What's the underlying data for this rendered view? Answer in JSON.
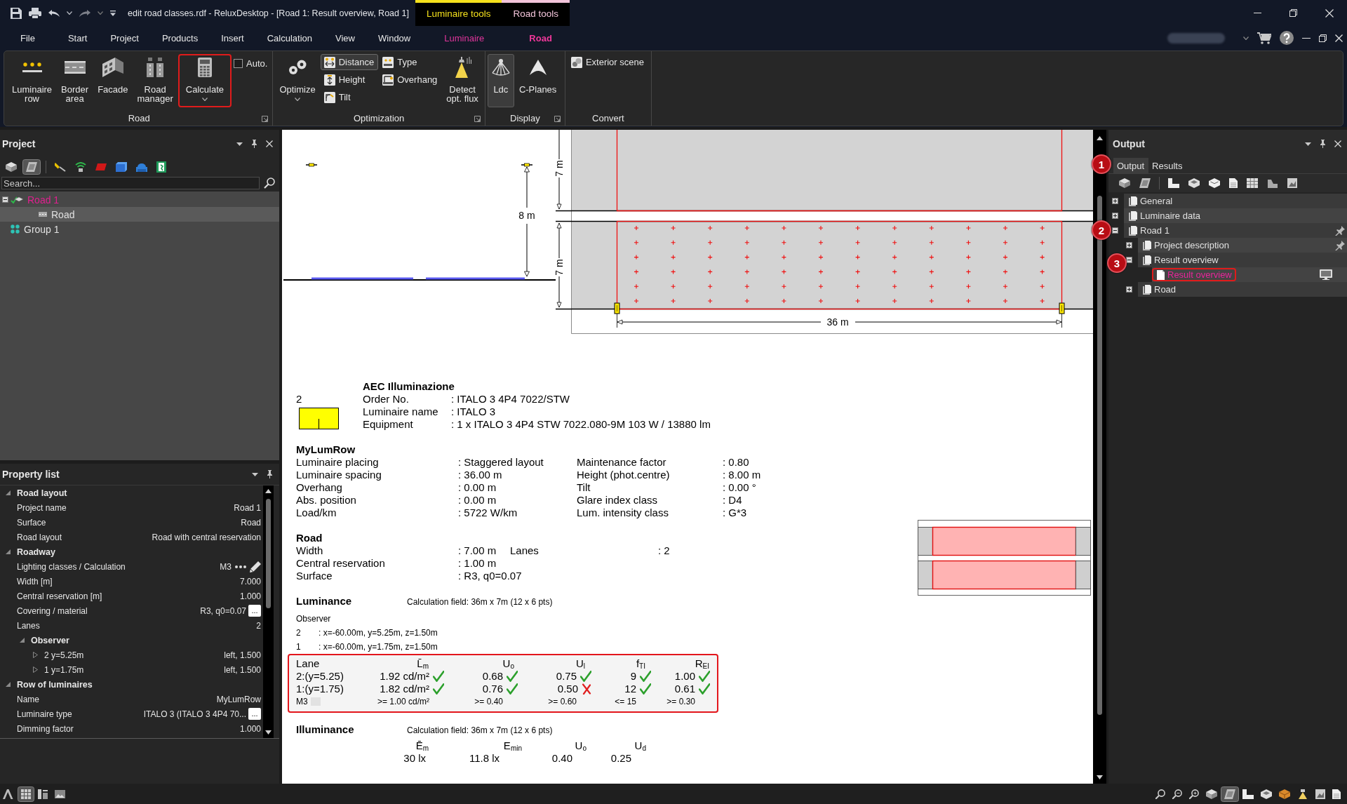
{
  "title_bar": {
    "title": "edit road classes.rdf - ReluxDesktop - [Road 1: Result overview, Road 1]",
    "context_tabs": [
      {
        "label": "Luminaire tools",
        "color": "#f5e11c"
      },
      {
        "label": "Road tools",
        "color": "#f2c4da"
      }
    ]
  },
  "menu": [
    {
      "label": "File",
      "kind": "main",
      "selected": false
    },
    {
      "label": "Start",
      "kind": "main",
      "selected": false
    },
    {
      "label": "Project",
      "kind": "main",
      "selected": false
    },
    {
      "label": "Products",
      "kind": "main",
      "selected": false
    },
    {
      "label": "Insert",
      "kind": "main",
      "selected": false
    },
    {
      "label": "Calculation",
      "kind": "main",
      "selected": false
    },
    {
      "label": "View",
      "kind": "main",
      "selected": false
    },
    {
      "label": "Window",
      "kind": "main",
      "selected": false
    },
    {
      "label": "Luminaire",
      "kind": "context",
      "selected": false
    },
    {
      "label": "Road",
      "kind": "context",
      "selected": true
    }
  ],
  "ribbon": [
    {
      "label": "Road",
      "launcher": true,
      "items": [
        {
          "kind": "large",
          "label": "Luminaire\nrow",
          "pressed": false,
          "dropdown": false,
          "highlighted": false
        },
        {
          "kind": "large",
          "label": "Border\narea",
          "pressed": false,
          "dropdown": false,
          "highlighted": false
        },
        {
          "kind": "large",
          "label": "Facade",
          "pressed": false,
          "dropdown": false,
          "highlighted": false
        },
        {
          "kind": "large",
          "label": "Road\nmanager",
          "pressed": false,
          "dropdown": false,
          "highlighted": false
        },
        {
          "kind": "large",
          "label": "Calculate",
          "pressed": false,
          "dropdown": true,
          "highlighted": true
        },
        {
          "kind": "checkbox",
          "label": "Auto.",
          "checked": false
        }
      ]
    },
    {
      "label": "Optimization",
      "launcher": true,
      "items": [
        {
          "kind": "large",
          "label": "Optimize",
          "pressed": false,
          "dropdown": true,
          "highlighted": false
        },
        {
          "kind": "stack",
          "buttons": [
            {
              "label": "Distance",
              "pressed": true
            },
            {
              "label": "Height",
              "pressed": false
            },
            {
              "label": "Tilt",
              "pressed": false
            }
          ]
        },
        {
          "kind": "stack",
          "buttons": [
            {
              "label": "Type",
              "pressed": false
            },
            {
              "label": "Overhang",
              "pressed": false
            }
          ]
        },
        {
          "kind": "large",
          "label": "Detect\nopt. flux",
          "pressed": false,
          "dropdown": false,
          "highlighted": false
        }
      ]
    },
    {
      "label": "Display",
      "launcher": true,
      "items": [
        {
          "kind": "large",
          "label": "Ldc",
          "pressed": true,
          "dropdown": false,
          "highlighted": false
        },
        {
          "kind": "large",
          "label": "C-Planes",
          "pressed": false,
          "dropdown": false,
          "highlighted": false
        }
      ]
    },
    {
      "label": "Convert",
      "launcher": false,
      "items": [
        {
          "kind": "stack",
          "buttons": [
            {
              "label": "Exterior scene",
              "pressed": false
            }
          ]
        }
      ]
    }
  ],
  "project_panel": {
    "title": "Project",
    "toolbar": [
      {
        "pressed": false
      },
      {
        "pressed": true
      },
      {
        "pressed": false
      },
      {
        "pressed": false
      },
      {
        "pressed": false
      },
      {
        "pressed": false
      },
      {
        "pressed": false
      },
      {
        "pressed": false
      }
    ],
    "search": {
      "placeholder": "Search..."
    },
    "tree": [
      {
        "label": "Road 1",
        "kind": "project",
        "active": true,
        "selected": false,
        "expanded": true,
        "children": [
          {
            "label": "Road",
            "kind": "road",
            "active": false,
            "selected": true
          }
        ]
      },
      {
        "label": "Group 1",
        "kind": "group",
        "active": false,
        "selected": false
      }
    ]
  },
  "property_list": {
    "title": "Property list",
    "sections": [
      {
        "label": "Road layout",
        "expanded": true,
        "rows": [
          {
            "kind": "value",
            "name": "Project name",
            "value": "Road 1"
          },
          {
            "kind": "value",
            "name": "Surface",
            "value": "Road"
          },
          {
            "kind": "value",
            "name": "Road layout",
            "value": "Road with central reservation"
          }
        ]
      },
      {
        "label": "Roadway",
        "expanded": true,
        "rows": [
          {
            "kind": "edit",
            "name": "Lighting classes / Calculation",
            "value": "M3"
          },
          {
            "kind": "value",
            "name": "Width [m]",
            "value": "7.000"
          },
          {
            "kind": "value",
            "name": "Central reservation [m]",
            "value": "1.000"
          },
          {
            "kind": "browse",
            "name": "Covering / material",
            "value": "R3, q0=0.07",
            "button": "..."
          },
          {
            "kind": "value",
            "name": "Lanes",
            "value": "2"
          },
          {
            "kind": "group",
            "name": "Observer",
            "expanded": true,
            "children": [
              {
                "kind": "item",
                "name": "2 y=5.25m",
                "value": "left, 1.500",
                "expanded": false
              },
              {
                "kind": "item",
                "name": "1 y=1.75m",
                "value": "left, 1.500",
                "expanded": false
              }
            ]
          }
        ]
      },
      {
        "label": "Row of luminaires",
        "expanded": true,
        "rows": [
          {
            "kind": "value",
            "name": "Name",
            "value": "MyLumRow"
          },
          {
            "kind": "browse",
            "name": "Luminaire type",
            "value": "ITALO 3 (ITALO 3 4P4 70...",
            "button": "..."
          },
          {
            "kind": "value",
            "name": "Dimming factor",
            "value": "1.000"
          }
        ]
      }
    ]
  },
  "report": {
    "cross_section": {
      "height_label": "8 m"
    },
    "plan": {
      "width_labels": [
        "7 m",
        "7 m"
      ],
      "spacing_label": "36 m"
    },
    "luminaire": {
      "count": "2",
      "manufacturer": "AEC Illuminazione",
      "fields": [
        {
          "label": "Order No.",
          "value": ": ITALO 3 4P4 7022/STW"
        },
        {
          "label": "Luminaire name",
          "value": ": ITALO 3"
        },
        {
          "label": "Equipment",
          "value": ": 1 x ITALO 3 4P4 STW 7022.080-9M 103 W / 13880 lm"
        }
      ]
    },
    "luminaire_row": {
      "title": "MyLumRow",
      "rows": [
        {
          "label": "Luminaire placing",
          "value": ": Staggered layout",
          "label_2": "Maintenance factor",
          "value_2": ": 0.80"
        },
        {
          "label": "Luminaire spacing",
          "value": ": 36.00 m",
          "label_2": "Height (phot.centre)",
          "value_2": ": 8.00 m"
        },
        {
          "label": "Overhang",
          "value": ": 0.00 m",
          "label_2": "Tilt",
          "value_2": ": 0.00 °"
        },
        {
          "label": "Abs. position",
          "value": ": 0.00 m",
          "label_2": "Glare index class",
          "value_2": ": D4"
        },
        {
          "label": "Load/km",
          "value": ": 5722 W/km",
          "label_2": "Lum. intensity class",
          "value_2": ": G*3"
        }
      ]
    },
    "road": {
      "title": "Road",
      "rows": [
        {
          "label": "Width",
          "value": ": 7.00 m",
          "label_2": "Lanes",
          "value_2": ": 2"
        },
        {
          "label": "Central reservation",
          "value": ": 1.00 m"
        },
        {
          "label": "Surface",
          "value": ": R3, q0=0.07"
        }
      ]
    },
    "luminance": {
      "title": "Luminance",
      "field_note": "Calculation field: 36m x 7m (12 x 6 pts)",
      "observer_title": "Observer",
      "observers": [
        {
          "lane": "2",
          "position": ": x=-60.00m, y=5.25m, z=1.50m"
        },
        {
          "lane": "1",
          "position": ": x=-60.00m, y=1.75m, z=1.50m"
        }
      ],
      "table": {
        "highlighted": true,
        "columns": [
          "Lane",
          "L̄$_{m}$",
          "U$_{o}$",
          "U$_{l}$",
          "f$_{TI}$",
          "R$_{EI}$"
        ],
        "rows": [
          {
            "kind": "result",
            "cells": [
              {
                "value": "2:(y=5.25)"
              },
              {
                "value": "1.92 cd/m²",
                "passed": true
              },
              {
                "value": "0.68",
                "passed": true
              },
              {
                "value": "0.75",
                "passed": true
              },
              {
                "value": "9",
                "passed": true
              },
              {
                "value": "1.00",
                "passed": true
              }
            ]
          },
          {
            "kind": "result",
            "cells": [
              {
                "value": "1:(y=1.75)"
              },
              {
                "value": "1.82 cd/m²",
                "passed": true
              },
              {
                "value": "0.76",
                "passed": true
              },
              {
                "value": "0.50",
                "passed": false
              },
              {
                "value": "12",
                "passed": true
              },
              {
                "value": "0.61",
                "passed": true
              }
            ]
          },
          {
            "kind": "requirement",
            "cells": [
              {
                "value": "M3"
              },
              {
                "value": ">= 1.00 cd/m²"
              },
              {
                "value": ">= 0.40"
              },
              {
                "value": ">= 0.60"
              },
              {
                "value": "<= 15"
              },
              {
                "value": ">= 0.30"
              }
            ]
          }
        ]
      }
    },
    "illuminance": {
      "title": "Illuminance",
      "field_note": "Calculation field: 36m x 7m (12 x 6 pts)",
      "columns": [
        "Ē$_{m}$",
        "E$_{min}$",
        "U$_{o}$",
        "U$_{d}$"
      ],
      "values": [
        "30 lx",
        "11.8 lx",
        "0.40",
        "0.25"
      ]
    }
  },
  "output_panel": {
    "title": "Output",
    "tabs": [
      {
        "label": "Output",
        "selected": true,
        "callout": "1"
      },
      {
        "label": "Results",
        "selected": false
      }
    ],
    "tree": [
      {
        "label": "General",
        "kind": "folder",
        "expanded": false,
        "selected": false,
        "highlighted": false,
        "pinned": false
      },
      {
        "label": "Luminaire data",
        "kind": "folder",
        "expanded": false,
        "selected": false,
        "highlighted": false,
        "pinned": false
      },
      {
        "label": "Road 1",
        "kind": "folder",
        "expanded": true,
        "selected": false,
        "highlighted": false,
        "pinned": true,
        "callout": "2",
        "children": [
          {
            "label": "Project description",
            "kind": "folder",
            "expanded": false,
            "selected": false,
            "highlighted": false,
            "pinned": true
          },
          {
            "label": "Result overview",
            "kind": "folder",
            "expanded": true,
            "selected": false,
            "highlighted": false,
            "pinned": false,
            "callout": "3",
            "children": [
              {
                "label": "Result overview",
                "kind": "page",
                "selected": true,
                "highlighted": true,
                "pinned": false
              }
            ]
          },
          {
            "label": "Road",
            "kind": "folder",
            "expanded": false,
            "selected": false,
            "highlighted": false,
            "pinned": false
          }
        ]
      }
    ]
  },
  "status_bar": {
    "left_tools": [
      {
        "pressed": true
      },
      {
        "pressed": false
      },
      {
        "pressed": false
      }
    ],
    "right_tools": [
      {
        "pressed": false
      },
      {
        "pressed": false
      },
      {
        "pressed": false
      },
      {
        "pressed": false
      },
      {
        "pressed": true
      },
      {
        "pressed": false
      },
      {
        "pressed": false
      },
      {
        "pressed": false
      },
      {
        "pressed": false
      },
      {
        "pressed": false
      },
      {
        "pressed": false
      }
    ]
  }
}
